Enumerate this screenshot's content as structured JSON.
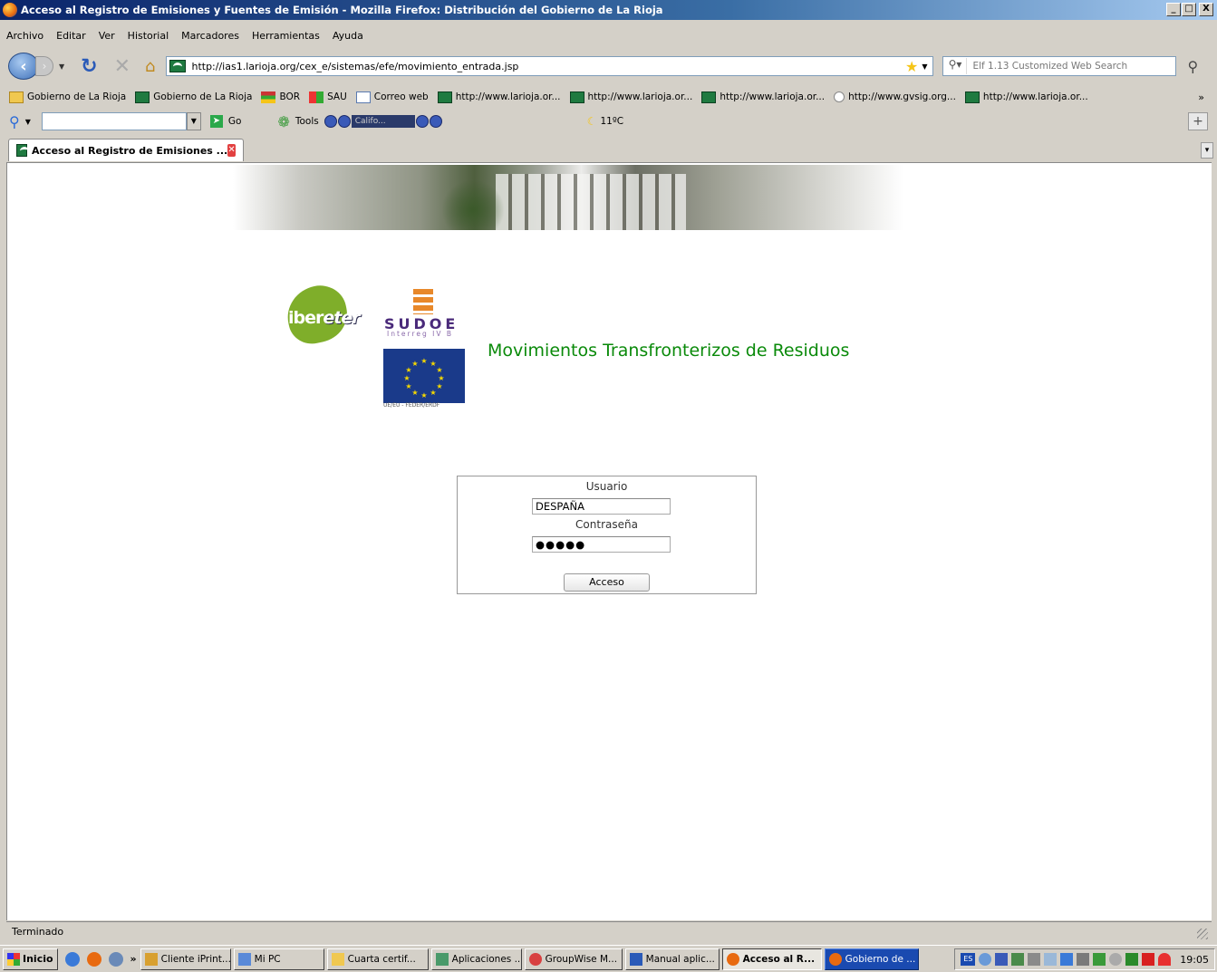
{
  "window": {
    "title": "Acceso al Registro de Emisiones y Fuentes de Emisión - Mozilla Firefox: Distribución del Gobierno de La Rioja",
    "controls": [
      "_",
      "□",
      "X"
    ]
  },
  "menu": {
    "items": [
      "Archivo",
      "Editar",
      "Ver",
      "Historial",
      "Marcadores",
      "Herramientas",
      "Ayuda"
    ]
  },
  "nav": {
    "url": "http://ias1.larioja.org/cex_e/sistemas/efe/movimiento_entrada.jsp",
    "search_placeholder": "Elf 1.13 Customized Web Search"
  },
  "bookmarks": {
    "items": [
      {
        "label": "Gobierno de La Rioja",
        "icon": "folder-icon"
      },
      {
        "label": "Gobierno de La Rioja",
        "icon": "site-icon"
      },
      {
        "label": "BOR",
        "icon": "bor-icon"
      },
      {
        "label": "SAU",
        "icon": "sau-icon"
      },
      {
        "label": "Correo web",
        "icon": "doc-icon"
      },
      {
        "label": "http://www.larioja.or...",
        "icon": "site-icon"
      },
      {
        "label": "http://www.larioja.or...",
        "icon": "site-icon"
      },
      {
        "label": "http://www.larioja.or...",
        "icon": "site-icon"
      },
      {
        "label": "http://www.gvsig.org...",
        "icon": "gvsig-icon"
      },
      {
        "label": "http://www.larioja.or...",
        "icon": "site-icon"
      }
    ],
    "more": "»"
  },
  "toolbar2": {
    "go_label": "Go",
    "tools_label": "Tools",
    "media_station": "Califo...",
    "weather": "11ºC"
  },
  "tab": {
    "title": "Acceso al Registro de Emisiones ..."
  },
  "page": {
    "ibereter_a": "iber",
    "ibereter_b": "eter",
    "sudoe": "SUDOE",
    "interreg": "Interreg IV B",
    "eu_caption": "UE/EU - FEDER/ERDF",
    "app_title": "Movimientos Transfronterizos de Residuos",
    "login": {
      "user_label": "Usuario",
      "user_value": "DESPAÑA",
      "pass_label": "Contraseña",
      "pass_value": "●●●●●",
      "submit_label": "Acceso"
    }
  },
  "status": {
    "text": "Terminado"
  },
  "taskbar": {
    "start_label": "Inicio",
    "more": "»",
    "tasks": [
      {
        "label": "Cliente iPrint...",
        "active": false
      },
      {
        "label": "Mi PC",
        "active": false
      },
      {
        "label": "Cuarta certif...",
        "active": false
      },
      {
        "label": "Aplicaciones ...",
        "active": false
      },
      {
        "label": "GroupWise M...",
        "active": false
      },
      {
        "label": "Manual aplic...",
        "active": false
      },
      {
        "label": "Acceso al R...",
        "active": true
      },
      {
        "label": "Gobierno de ...",
        "active": false
      }
    ],
    "tray_lang": "ES",
    "clock": "19:05"
  }
}
